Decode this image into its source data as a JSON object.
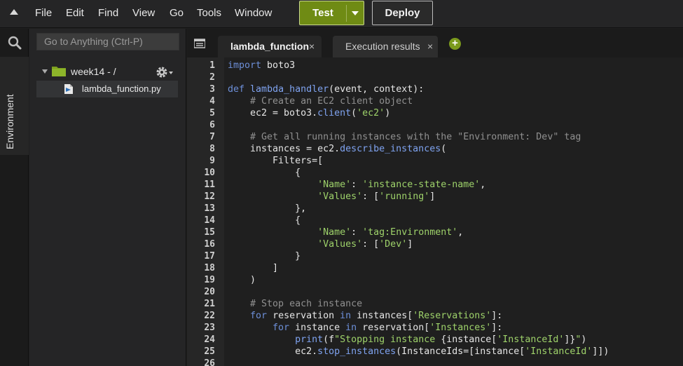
{
  "menu": {
    "items": [
      "File",
      "Edit",
      "Find",
      "View",
      "Go",
      "Tools",
      "Window"
    ],
    "test_label": "Test",
    "deploy_label": "Deploy"
  },
  "sidebar": {
    "goto_placeholder": "Go to Anything (Ctrl-P)",
    "environment_label": "Environment",
    "folder_name": "week14 - /",
    "file_name": "lambda_function.py"
  },
  "tabs": [
    {
      "label": "lambda_function",
      "active": true
    },
    {
      "label": "Execution results",
      "active": false
    }
  ],
  "colors": {
    "test_button": "#6f8b14",
    "keyword": "#6d8fd8",
    "string": "#9ed26a",
    "comment": "#909090"
  },
  "code_lines": [
    [
      [
        "kw",
        "import"
      ],
      [
        "plain",
        " boto3"
      ]
    ],
    [],
    [
      [
        "kw",
        "def"
      ],
      [
        "plain",
        " "
      ],
      [
        "fn",
        "lambda_handler"
      ],
      [
        "plain",
        "(event, context):"
      ]
    ],
    [
      [
        "plain",
        "    "
      ],
      [
        "cm",
        "# Create an EC2 client object"
      ]
    ],
    [
      [
        "plain",
        "    ec2 = boto3."
      ],
      [
        "fn",
        "client"
      ],
      [
        "plain",
        "("
      ],
      [
        "str",
        "'ec2'"
      ],
      [
        "plain",
        ")"
      ]
    ],
    [],
    [
      [
        "plain",
        "    "
      ],
      [
        "cm",
        "# Get all running instances with the \"Environment: Dev\" tag"
      ]
    ],
    [
      [
        "plain",
        "    instances = ec2."
      ],
      [
        "fn",
        "describe_instances"
      ],
      [
        "plain",
        "("
      ]
    ],
    [
      [
        "plain",
        "        Filters=["
      ]
    ],
    [
      [
        "plain",
        "            {"
      ]
    ],
    [
      [
        "plain",
        "                "
      ],
      [
        "str",
        "'Name'"
      ],
      [
        "plain",
        ": "
      ],
      [
        "str",
        "'instance-state-name'"
      ],
      [
        "plain",
        ","
      ]
    ],
    [
      [
        "plain",
        "                "
      ],
      [
        "str",
        "'Values'"
      ],
      [
        "plain",
        ": ["
      ],
      [
        "str",
        "'running'"
      ],
      [
        "plain",
        "]"
      ]
    ],
    [
      [
        "plain",
        "            },"
      ]
    ],
    [
      [
        "plain",
        "            {"
      ]
    ],
    [
      [
        "plain",
        "                "
      ],
      [
        "str",
        "'Name'"
      ],
      [
        "plain",
        ": "
      ],
      [
        "str",
        "'tag:Environment'"
      ],
      [
        "plain",
        ","
      ]
    ],
    [
      [
        "plain",
        "                "
      ],
      [
        "str",
        "'Values'"
      ],
      [
        "plain",
        ": ["
      ],
      [
        "str",
        "'Dev'"
      ],
      [
        "plain",
        "]"
      ]
    ],
    [
      [
        "plain",
        "            }"
      ]
    ],
    [
      [
        "plain",
        "        ]"
      ]
    ],
    [
      [
        "plain",
        "    )"
      ]
    ],
    [],
    [
      [
        "plain",
        "    "
      ],
      [
        "cm",
        "# Stop each instance"
      ]
    ],
    [
      [
        "plain",
        "    "
      ],
      [
        "kw",
        "for"
      ],
      [
        "plain",
        " reservation "
      ],
      [
        "kw",
        "in"
      ],
      [
        "plain",
        " instances["
      ],
      [
        "str",
        "'Reservations'"
      ],
      [
        "plain",
        "]:"
      ]
    ],
    [
      [
        "plain",
        "        "
      ],
      [
        "kw",
        "for"
      ],
      [
        "plain",
        " instance "
      ],
      [
        "kw",
        "in"
      ],
      [
        "plain",
        " reservation["
      ],
      [
        "str",
        "'Instances'"
      ],
      [
        "plain",
        "]:"
      ]
    ],
    [
      [
        "plain",
        "            "
      ],
      [
        "fn",
        "print"
      ],
      [
        "plain",
        "(f"
      ],
      [
        "str",
        "\"Stopping instance "
      ],
      [
        "plain",
        "{instance["
      ],
      [
        "str",
        "'InstanceId'"
      ],
      [
        "plain",
        "]}"
      ],
      [
        "str",
        "\""
      ],
      [
        "plain",
        ")"
      ]
    ],
    [
      [
        "plain",
        "            ec2."
      ],
      [
        "fn",
        "stop_instances"
      ],
      [
        "plain",
        "(InstanceIds=[instance["
      ],
      [
        "str",
        "'InstanceId'"
      ],
      [
        "plain",
        "]])"
      ]
    ],
    []
  ]
}
